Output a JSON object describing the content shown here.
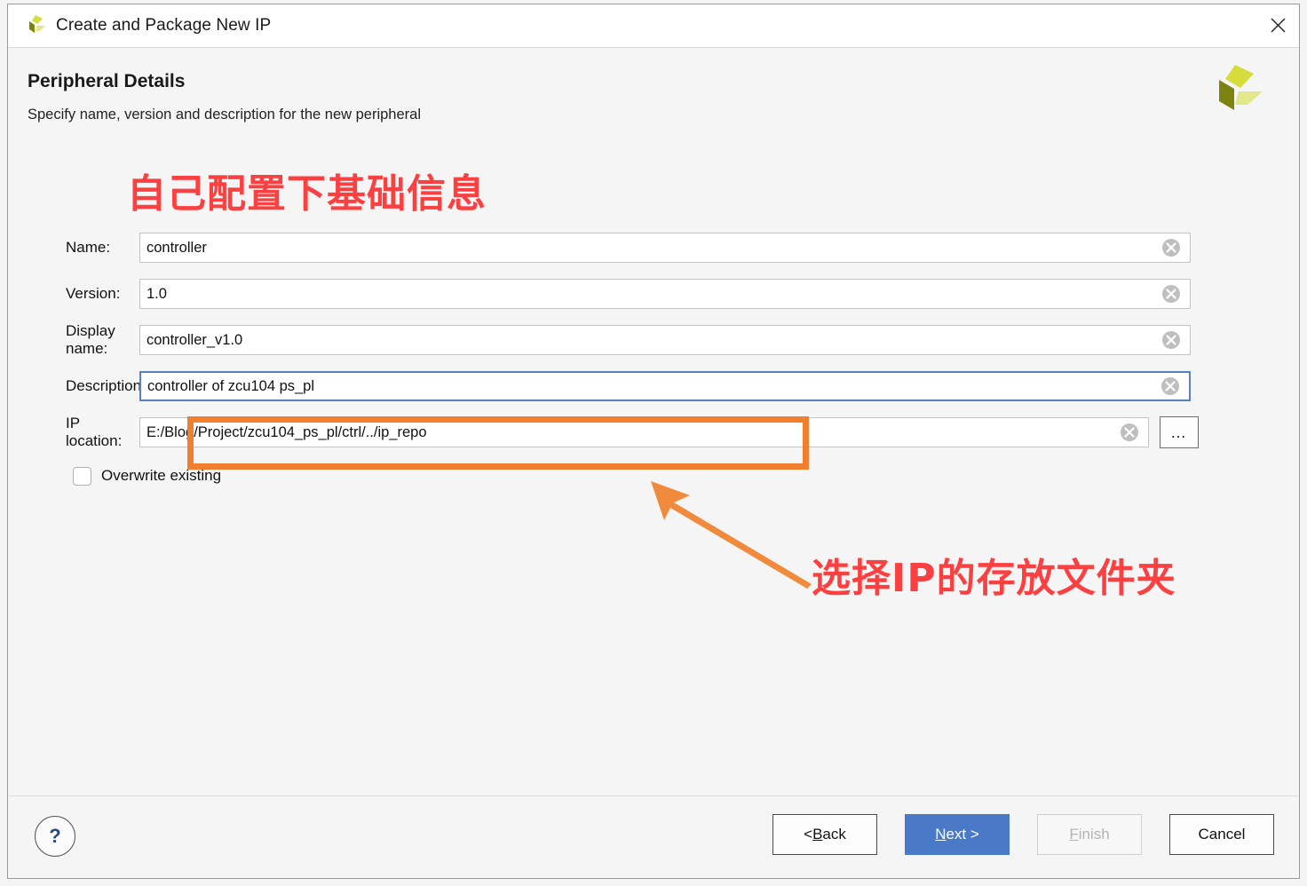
{
  "window": {
    "title": "Create and Package New IP",
    "logo_icon": "vivado-logo-icon",
    "close_icon": "close-icon"
  },
  "header": {
    "title": "Peripheral Details",
    "subtitle": "Specify name, version and description for the new peripheral",
    "brand_icon": "vivado-logo-icon"
  },
  "annotations": {
    "top": "自己配置下基础信息",
    "bottom": "选择IP的存放文件夹",
    "color": "#fa4040",
    "highlight_color": "#f08030",
    "arrow_icon": "arrow-up-left-icon"
  },
  "form": {
    "fields": [
      {
        "label": "Name:",
        "value": "controller",
        "name": "name-input",
        "clear_icon": "clear-circle-icon",
        "focused": false
      },
      {
        "label": "Version:",
        "value": "1.0",
        "name": "version-input",
        "clear_icon": "clear-circle-icon",
        "focused": false
      },
      {
        "label": "Display name:",
        "value": "controller_v1.0",
        "name": "display-name-input",
        "clear_icon": "clear-circle-icon",
        "focused": false
      },
      {
        "label": "Description:",
        "value": "controller of zcu104 ps_pl",
        "name": "description-input",
        "clear_icon": "clear-circle-icon",
        "focused": true
      }
    ],
    "ip_location": {
      "label": "IP location:",
      "value": "E:/Blog/Project/zcu104_ps_pl/ctrl/../ip_repo",
      "clear_icon": "clear-circle-icon",
      "browse_label": "…",
      "browse_icon": "ellipsis-icon"
    },
    "overwrite": {
      "label": "Overwrite existing",
      "checked": false
    }
  },
  "footer": {
    "help_label": "?",
    "help_icon": "question-mark-icon",
    "buttons": [
      {
        "name": "back-button",
        "prefix": "< ",
        "accel": "B",
        "suffix": "ack",
        "state": "normal"
      },
      {
        "name": "next-button",
        "prefix": "",
        "accel": "N",
        "suffix": "ext >",
        "state": "primary"
      },
      {
        "name": "finish-button",
        "prefix": "",
        "accel": "F",
        "suffix": "inish",
        "state": "disabled"
      },
      {
        "name": "cancel-button",
        "prefix": "Cancel",
        "accel": "",
        "suffix": "",
        "state": "normal"
      }
    ]
  }
}
